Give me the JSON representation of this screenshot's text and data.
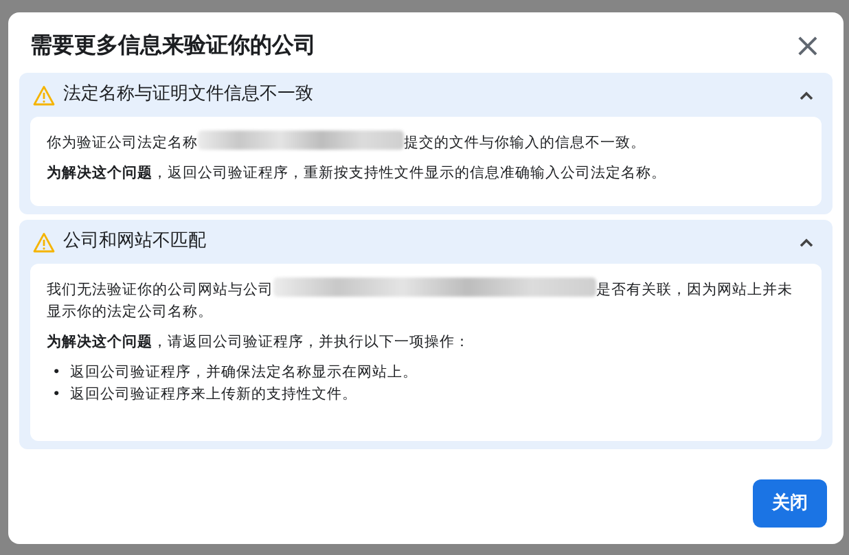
{
  "dialog": {
    "title": "需要更多信息来验证你的公司",
    "close_symbol": "×"
  },
  "issues": [
    {
      "title": "法定名称与证明文件信息不一致",
      "expanded": true,
      "paragraphs": [
        {
          "kind": "redacted",
          "before": "你为验证公司法定名称",
          "after": "提交的文件与你输入的信息不一致。"
        },
        {
          "kind": "text",
          "text": "**为解决这个问题**，返回公司验证程序，重新按支持性文件显示的信息准确输入公司法定名称。"
        }
      ]
    },
    {
      "title": "公司和网站不匹配",
      "expanded": true,
      "paragraphs": [
        {
          "kind": "redacted",
          "before": "我们无法验证你的公司网站与公司",
          "after": "是否有关联，因为网站上并未显示你的法定公司名称。"
        },
        {
          "kind": "text",
          "text": "**为解决这个问题**，请返回公司验证程序，并执行以下一项操作："
        }
      ],
      "bullets": [
        {
          "marker": "•",
          "text": "返回公司验证程序，并确保法定名称显示在网站上。"
        },
        {
          "marker": "•",
          "text": "返回公司验证程序来上传新的支持性文件。"
        }
      ]
    }
  ],
  "footer": {
    "button": "关闭"
  }
}
